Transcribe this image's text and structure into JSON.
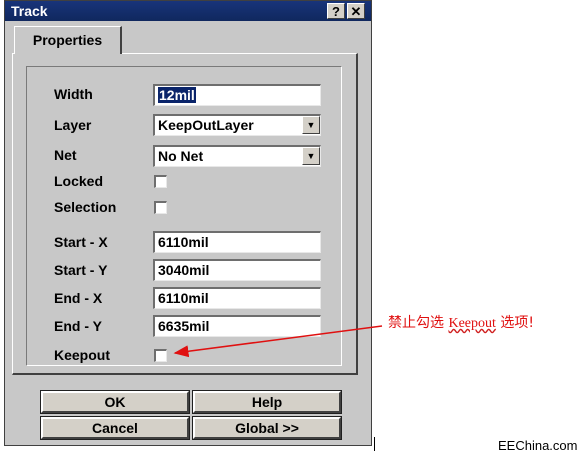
{
  "window": {
    "title": "Track",
    "help_btn": "?",
    "close_btn": "✕"
  },
  "tab": {
    "label": "Properties"
  },
  "fields": {
    "width": {
      "label": "Width",
      "value": "12mil"
    },
    "layer": {
      "label": "Layer",
      "value": "KeepOutLayer"
    },
    "net": {
      "label": "Net",
      "value": "No Net"
    },
    "locked": {
      "label": "Locked",
      "checked": false
    },
    "selection": {
      "label": "Selection",
      "checked": false
    },
    "start_x": {
      "label": "Start - X",
      "value": "6110mil"
    },
    "start_y": {
      "label": "Start - Y",
      "value": "3040mil"
    },
    "end_x": {
      "label": "End - X",
      "value": "6110mil"
    },
    "end_y": {
      "label": "End - Y",
      "value": "6635mil"
    },
    "keepout": {
      "label": "Keepout",
      "checked": false
    }
  },
  "buttons": {
    "ok": "OK",
    "help": "Help",
    "cancel": "Cancel",
    "global": "Global >>"
  },
  "annotation": {
    "prefix": "禁止勾选 ",
    "keyword": "Keepout",
    "suffix": " 选项!"
  },
  "watermark": "EEChina.com",
  "colors": {
    "title_bar": "#10285e",
    "annotation": "#e01010",
    "selection_highlight": "#0a246a"
  }
}
